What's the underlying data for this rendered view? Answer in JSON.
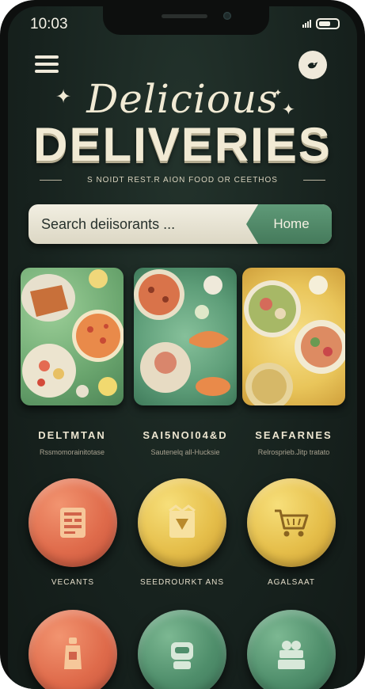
{
  "status_bar": {
    "time": "10:03"
  },
  "header": {
    "title_script": "Delicious",
    "title_main": "DELIVERIES",
    "subtitle": "S NOIDT REST.R AION  FOOD OR CEETHOS"
  },
  "search": {
    "placeholder": "Search deiisorants ...",
    "button_label": "Home"
  },
  "categories": [
    {
      "title": "DELTMTAN",
      "subtitle": "Rssmomorainitotase"
    },
    {
      "title": "SAI5NOI04&D",
      "subtitle": "Sautenelq all-Hucksie"
    },
    {
      "title": "SEAFARNES",
      "subtitle": "Relrosprieb.Jitp tratato"
    }
  ],
  "action_buttons": [
    {
      "label": "VECANTS",
      "icon": "receipt-icon",
      "color": "#df6b4b"
    },
    {
      "label": "SEEDROURKT ANS",
      "icon": "delivery-box-icon",
      "color": "#e5be4a"
    },
    {
      "label": "AGALSAAT",
      "icon": "shopping-cart-icon",
      "color": "#e5be4a"
    },
    {
      "label": "",
      "icon": "drink-bottle-icon",
      "color": "#df6b4b"
    },
    {
      "label": "",
      "icon": "robot-icon",
      "color": "#4f8e6b"
    },
    {
      "label": "",
      "icon": "cake-icon",
      "color": "#4f8e6b"
    }
  ],
  "colors": {
    "background": "#17221e",
    "accent_green": "#457a5b",
    "cream": "#f1ead4"
  }
}
